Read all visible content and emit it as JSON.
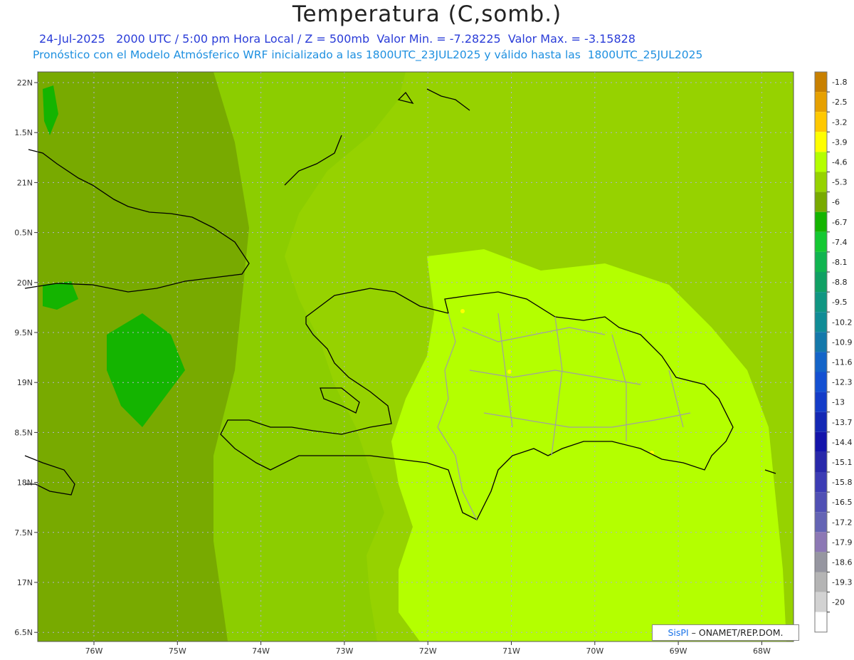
{
  "header": {
    "title": "Temperatura (C,somb.)",
    "subtitle_1": "24-Jul-2025   2000 UTC / 5:00 pm Hora Local / Z = 500mb  Valor Min. = -7.28225  Valor Max. = -3.15828",
    "subtitle_2": "Pronóstico con el Modelo Atmósferico WRF inicializado a las 1800UTC_23JUL2025 y válido hasta las  1800UTC_25JUL2025"
  },
  "axes": {
    "lon_labels": [
      "76W",
      "75W",
      "74W",
      "73W",
      "72W",
      "71W",
      "70W",
      "69W",
      "68W"
    ],
    "lat_labels": [
      "22N",
      "1.5N",
      "21N",
      "0.5N",
      "20N",
      "9.5N",
      "19N",
      "8.5N",
      "18N",
      "7.5N",
      "17N",
      "6.5N"
    ]
  },
  "colorbar": {
    "labels": [
      "-1.8",
      "-2.5",
      "-3.2",
      "-3.9",
      "-4.6",
      "-5.3",
      "-6",
      "-6.7",
      "-7.4",
      "-8.1",
      "-8.8",
      "-9.5",
      "-10.2",
      "-10.9",
      "-11.6",
      "-12.3",
      "-13",
      "-13.7",
      "-14.4",
      "-15.1",
      "-15.8",
      "-16.5",
      "-17.2",
      "-17.9",
      "-18.6",
      "-19.3",
      "-20"
    ],
    "colors": [
      "#c88000",
      "#e6a000",
      "#ffc800",
      "#ffff00",
      "#b4ff00",
      "#96d200",
      "#78aa00",
      "#14b400",
      "#14c832",
      "#10b450",
      "#10a064",
      "#109682",
      "#108c96",
      "#1478aa",
      "#1464c8",
      "#1450d2",
      "#143cc8",
      "#1428b4",
      "#1414aa",
      "#2828aa",
      "#3c3cb4",
      "#5050b4",
      "#6464b4",
      "#8c78b4",
      "#9696a0",
      "#b4b4b4",
      "#d2d2d2",
      "#ffffff"
    ]
  },
  "map_colors": {
    "band_m6": "#78aa00",
    "band_m53": "#8ccd00",
    "band_m46": "#96d200",
    "band_m39": "#b4ff00",
    "band_m32": "#ffff00",
    "band_m74": "#14b400",
    "coast": "#000000",
    "border": "#a0a0a0",
    "grid": "#b0b0d0"
  },
  "credit": {
    "brand": "SisPI",
    "text": "ONAMET/REP.DOM."
  }
}
